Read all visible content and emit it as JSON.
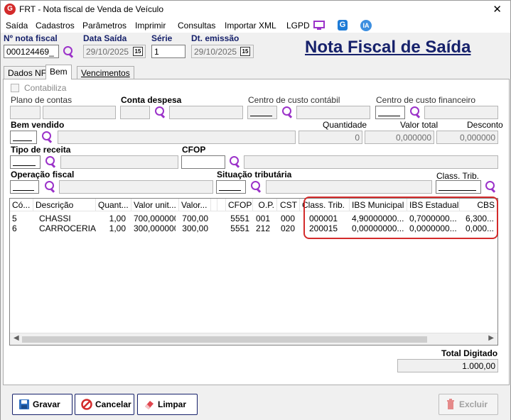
{
  "window": {
    "title": "FRT - Nota fiscal de Venda de Veículo",
    "app_icon": "app-logo-icon",
    "close": "✕"
  },
  "menu": {
    "items": [
      "Saída",
      "Cadastros",
      "Parâmetros",
      "Imprimir",
      "Consultas",
      "Importar XML",
      "LGPD"
    ],
    "icons": [
      "monitor-icon",
      "g-badge-icon",
      "ia-badge-icon"
    ],
    "ia_text": "IA",
    "g_text": "G"
  },
  "header": {
    "nota_label": "Nº nota fiscal",
    "nota_value": "000124469_",
    "data_saida_label": "Data Saída",
    "data_saida_value": "29/10/2025",
    "serie_label": "Série",
    "serie_value": "1",
    "dt_emissao_label": "Dt. emissão",
    "dt_emissao_value": "29/10/2025",
    "calendar_text": "15",
    "page_title": "Nota Fiscal de Saída"
  },
  "tabs": [
    "Dados NF",
    "Bem",
    "Vencimentos"
  ],
  "form": {
    "contabiliza": "Contabiliza",
    "plano_contas": "Plano de contas",
    "conta_despesa": "Conta despesa",
    "centro_custo_contabil": "Centro de custo contábil",
    "centro_custo_financeiro": "Centro de custo financeiro",
    "bem_vendido": "Bem vendido",
    "quantidade_label": "Quantidade",
    "quantidade_value": "0",
    "valor_total_label": "Valor total",
    "valor_total_value": "0,000000",
    "desconto_label": "Desconto",
    "desconto_value": "0,000000",
    "tipo_receita": "Tipo de receita",
    "cfop": "CFOP",
    "operacao_fiscal": "Operação fiscal",
    "situacao_tributaria": "Situação tributária",
    "class_trib": "Class. Trib."
  },
  "grid": {
    "columns": [
      "Có...",
      "Descrição",
      "Quant...",
      "Valor unit...",
      "Valor...",
      "",
      "",
      "CFOP",
      "O.P.",
      "CST",
      "Class. Trib.",
      "IBS Municipal",
      "IBS Estadual",
      "CBS"
    ],
    "rows": [
      [
        "5",
        "CHASSI",
        "1,00",
        "700,000000",
        "700,00",
        "",
        "",
        "5551",
        "001",
        "000",
        "000001",
        "4,90000000...",
        "0,7000000...",
        "6,300..."
      ],
      [
        "6",
        "CARROCERIA",
        "1,00",
        "300,000000",
        "300,00",
        "",
        "",
        "5551",
        "212",
        "020",
        "200015",
        "0,00000000...",
        "0,0000000...",
        "0,000..."
      ]
    ]
  },
  "totals": {
    "label": "Total Digitado",
    "value": "1.000,00"
  },
  "buttons": {
    "gravar": "Gravar",
    "cancelar": "Cancelar",
    "limpar": "Limpar",
    "excluir": "Excluir"
  },
  "colors": {
    "accent": "#16216b",
    "search": "#9b32c9",
    "highlight": "#d32b2b"
  }
}
